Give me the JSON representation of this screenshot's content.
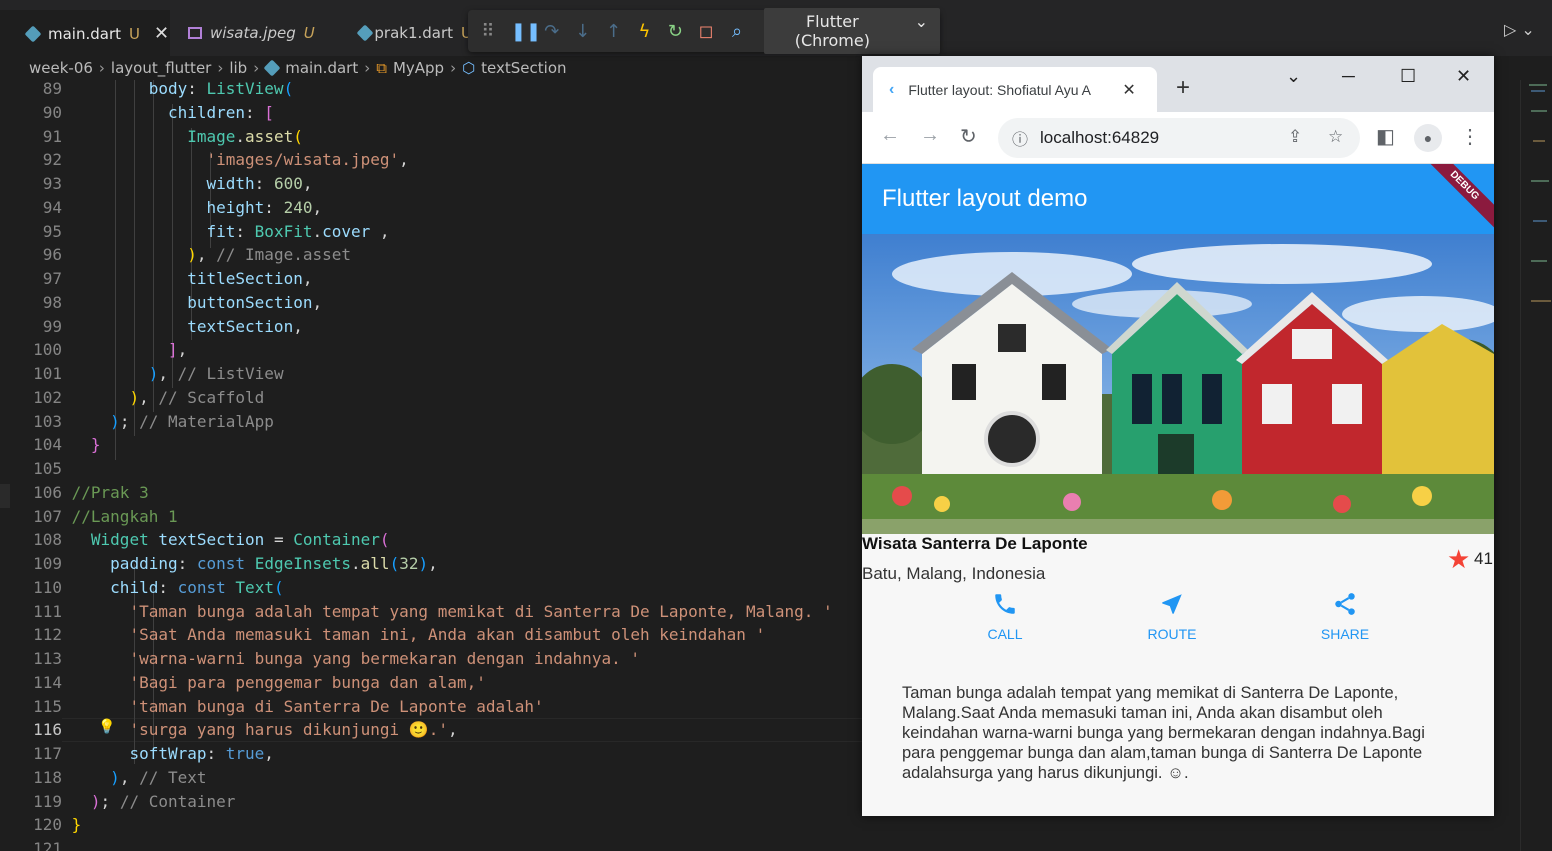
{
  "tabs": [
    {
      "label": "main.dart",
      "mod": "U",
      "close": "✕"
    },
    {
      "label": "wisata.jpeg",
      "mod": "U"
    },
    {
      "label": "prak1.dart",
      "mod": "U"
    }
  ],
  "debug_toolbar": {
    "device": "Flutter (Chrome)"
  },
  "breadcrumb": [
    "week-06",
    "layout_flutter",
    "lib",
    "main.dart",
    "MyApp",
    "textSection"
  ],
  "editor": {
    "current_line": "116",
    "lines": [
      {
        "n": "89"
      },
      {
        "n": "90"
      },
      {
        "n": "91"
      },
      {
        "n": "92"
      },
      {
        "n": "93"
      },
      {
        "n": "94"
      },
      {
        "n": "95"
      },
      {
        "n": "96"
      },
      {
        "n": "97"
      },
      {
        "n": "98"
      },
      {
        "n": "99"
      },
      {
        "n": "100"
      },
      {
        "n": "101"
      },
      {
        "n": "102"
      },
      {
        "n": "103"
      },
      {
        "n": "104"
      },
      {
        "n": "105"
      },
      {
        "n": "106"
      },
      {
        "n": "107"
      },
      {
        "n": "108"
      },
      {
        "n": "109"
      },
      {
        "n": "110"
      },
      {
        "n": "111"
      },
      {
        "n": "112"
      },
      {
        "n": "113"
      },
      {
        "n": "114"
      },
      {
        "n": "115"
      },
      {
        "n": "116"
      },
      {
        "n": "117"
      },
      {
        "n": "118"
      },
      {
        "n": "119"
      },
      {
        "n": "120"
      },
      {
        "n": "121"
      }
    ]
  },
  "browser": {
    "tab_title": "Flutter layout: Shofiatul Ayu A",
    "url": "localhost:64829",
    "new_tab": "+"
  },
  "app": {
    "title": "Flutter layout demo",
    "debug_banner": "DEBUG",
    "place_title": "Wisata Santerra De Laponte",
    "location": "Batu, Malang, Indonesia",
    "rating_count": "41",
    "buttons": [
      {
        "label": "CALL",
        "icon": "phone-icon"
      },
      {
        "label": "ROUTE",
        "icon": "near-me-icon"
      },
      {
        "label": "SHARE",
        "icon": "share-icon"
      }
    ],
    "description": "Taman bunga adalah tempat yang memikat di Santerra De Laponte, Malang.Saat Anda memasuki taman ini, Anda akan disambut oleh keindahan warna-warni bunga yang bermekaran dengan indahnya.Bagi para penggemar bunga dan alam,taman bunga di Santerra De Laponte adalahsurga yang harus dikunjungi. ☺."
  },
  "colors": {
    "appbar": "#2196f3",
    "accent_icon": "#2196f3",
    "star": "#f44336",
    "debug_banner": "#8b1a3e"
  }
}
